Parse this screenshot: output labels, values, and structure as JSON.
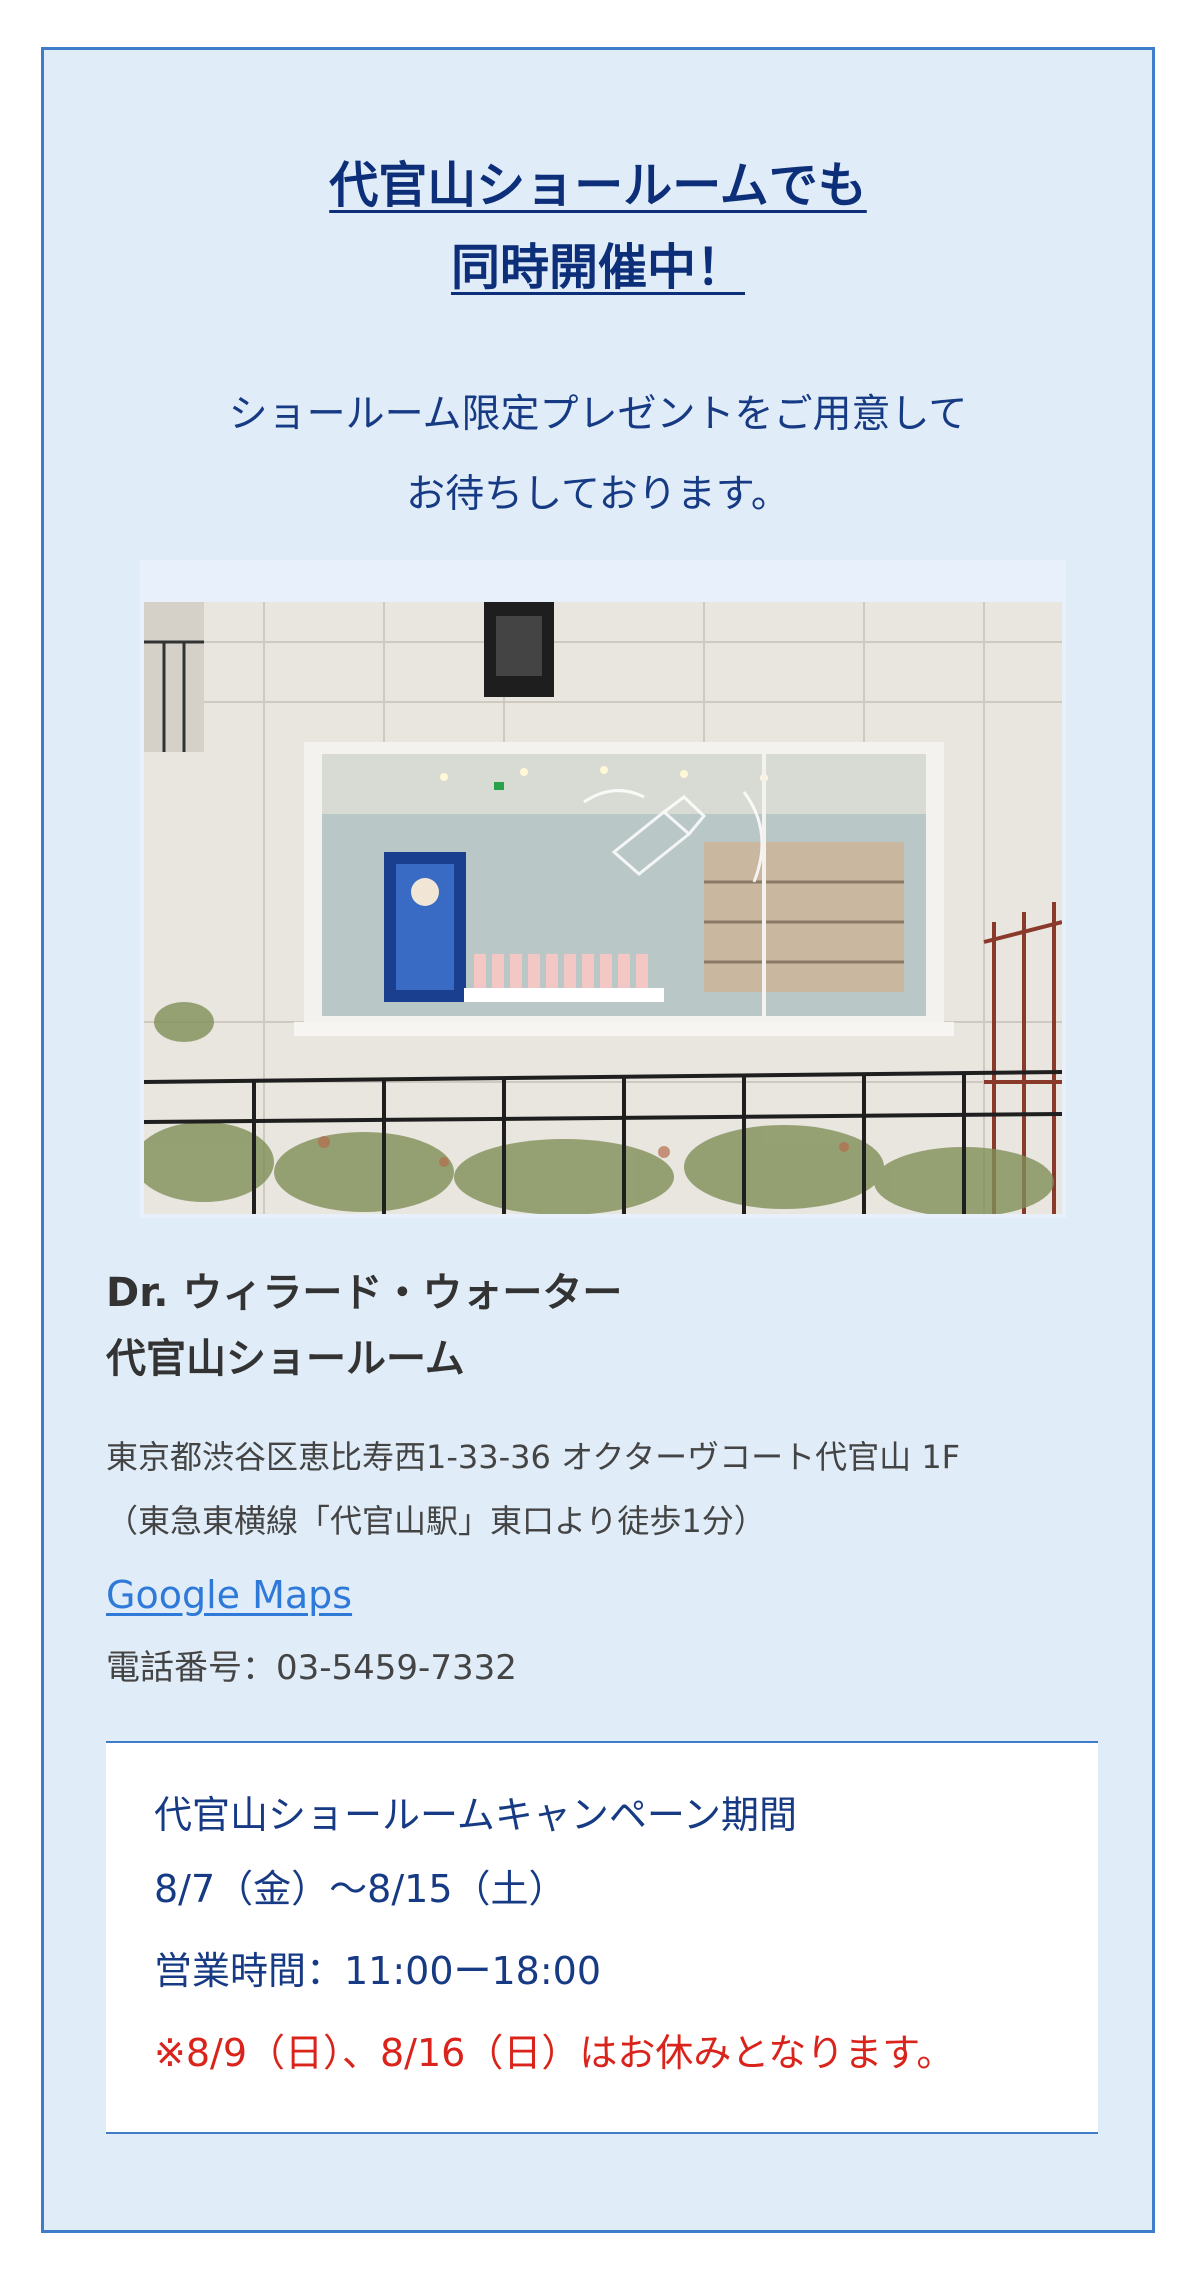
{
  "headline": {
    "line1": "代官山ショールームでも",
    "line2": "同時開催中！"
  },
  "lead": {
    "line1": "ショールーム限定プレゼントをご用意して",
    "line2": "お待ちしております。"
  },
  "photo": {
    "description_icon": "storefront-photo"
  },
  "showroom": {
    "name_line1": "Dr. ウィラード・ウォーター",
    "name_line2": "代官山ショールーム",
    "address_line1": "東京都渋谷区恵比寿西1-33-36 オクターヴコート代官山 1F",
    "address_line2": "（東急東横線「代官山駅」東口より徒歩1分）",
    "maps_link": "Google Maps",
    "phone": "電話番号：03-5459-7332"
  },
  "campaign": {
    "title": "代官山ショールームキャンペーン期間",
    "period": "8/7（金）〜8/15（土）",
    "hours": "営業時間：11:00ー18:00",
    "closed_note": "※8/9（日）、8/16（日）はお休みとなります。"
  },
  "colors": {
    "frame_border": "#3f7cc9",
    "frame_bg": "#e0edf8",
    "heading": "#0d2f7a",
    "link": "#2f7ad9",
    "alert": "#d9231b"
  }
}
